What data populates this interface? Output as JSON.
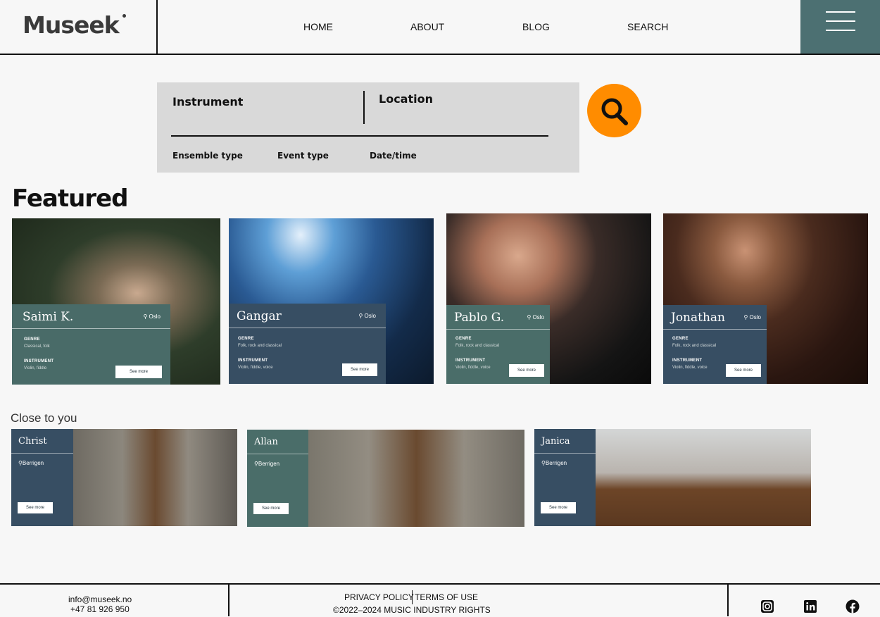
{
  "brand": {
    "logo": "Museek"
  },
  "nav": {
    "items": [
      "HOME",
      "ABOUT",
      "BLOG",
      "SEARCH"
    ]
  },
  "search": {
    "instrument_label": "Instrument",
    "location_label": "Location",
    "filters": [
      "Ensemble type",
      "Event type",
      "Date/time"
    ]
  },
  "featured": {
    "title": "Featured",
    "cards": [
      {
        "name": "Saimi K.",
        "location": "Oslo",
        "genre_label": "GENRE",
        "genre": "Classical, folk",
        "instrument_label": "INSTRUMENT",
        "instrument": "Violin, fiddle",
        "button": "See more"
      },
      {
        "name": "Gangar",
        "location": "Oslo",
        "genre_label": "GENRE",
        "genre": "Folk, rock and classical",
        "instrument_label": "INSTRUMENT",
        "instrument": "Violin, fiddle, voice",
        "button": "See more"
      },
      {
        "name": "Pablo G.",
        "location": "Oslo",
        "genre_label": "GENRE",
        "genre": "Folk, rock and classical",
        "instrument_label": "INSTRUMENT",
        "instrument": "Violin, fiddle, voice",
        "button": "See more"
      },
      {
        "name": "Jonathan",
        "location": "Oslo",
        "genre_label": "GENRE",
        "genre": "Folk, rock and classical",
        "instrument_label": "INSTRUMENT",
        "instrument": "Violin, fiddle, voice",
        "button": "See more"
      }
    ]
  },
  "close": {
    "title": "Close to you",
    "cards": [
      {
        "name": "Christ",
        "location": "Berrigen",
        "button": "See more"
      },
      {
        "name": "Allan",
        "location": "Berrigen",
        "button": "See more"
      },
      {
        "name": "Janica",
        "location": "Berrigen",
        "button": "See more"
      }
    ]
  },
  "footer": {
    "email": "info@museek.no",
    "phone": "+47 81 926 950",
    "privacy": "PRIVACY POLICY",
    "terms": "TERMS OF USE",
    "copyright": "©2022–2024 MUSIC INDUSTRY RIGHTS"
  },
  "colors": {
    "accent_teal": "#4c7072",
    "card_slate": "#374e63",
    "search_orange": "#ff8c00",
    "panel_gray": "#d9d9d9"
  },
  "icons": [
    "search-icon",
    "menu-icon",
    "pin-icon",
    "instagram-icon",
    "linkedin-icon",
    "facebook-icon"
  ]
}
